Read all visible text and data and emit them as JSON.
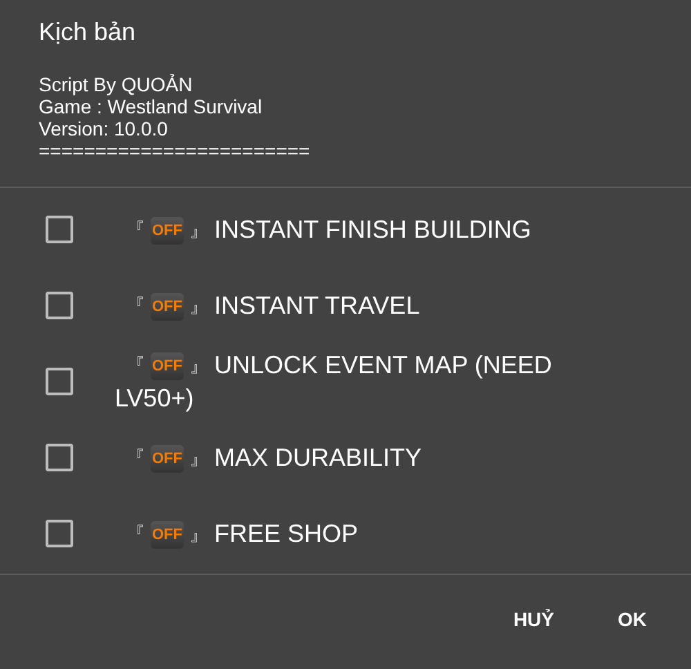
{
  "dialog": {
    "title": "Kịch bản",
    "info": [
      "Script By QUOẢN",
      "Game : Westland Survival",
      "Version: 10.0.0",
      "========================"
    ],
    "options": [
      {
        "open": "『",
        "badge": "OFF",
        "close": "』",
        "label": "INSTANT FINISH BUILDING",
        "checked": false
      },
      {
        "open": "『",
        "badge": "OFF",
        "close": "』",
        "label": "INSTANT TRAVEL",
        "checked": false
      },
      {
        "open": "『",
        "badge": "OFF",
        "close": "』",
        "label": "UNLOCK EVENT MAP (NEED LV50+)",
        "checked": false
      },
      {
        "open": "『",
        "badge": "OFF",
        "close": "』",
        "label": "MAX DURABILITY",
        "checked": false
      },
      {
        "open": "『",
        "badge": "OFF",
        "close": "』",
        "label": "FREE SHOP",
        "checked": false
      }
    ],
    "buttons": [
      "HUỶ",
      "OK"
    ]
  }
}
